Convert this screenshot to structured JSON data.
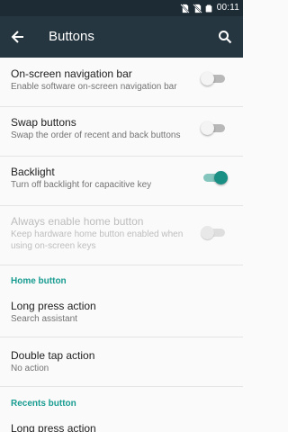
{
  "status_bar": {
    "time": "00:11",
    "icons": [
      "no-sim-icon",
      "no-sim-icon",
      "battery-icon"
    ]
  },
  "app_bar": {
    "title": "Buttons",
    "back_icon": "back-arrow-icon",
    "search_icon": "search-icon"
  },
  "settings": [
    {
      "title": "On-screen navigation bar",
      "subtitle": "Enable software on-screen navigation bar",
      "toggle": "off"
    },
    {
      "title": "Swap buttons",
      "subtitle": "Swap the order of recent and back buttons",
      "toggle": "off"
    },
    {
      "title": "Backlight",
      "subtitle": "Turn off backlight for capacitive key",
      "toggle": "on"
    },
    {
      "title": "Always enable home button",
      "subtitle": "Keep hardware home button enabled when using on-screen keys",
      "toggle": "off",
      "enabled": false
    }
  ],
  "home_button_section": {
    "header": "Home button",
    "items": [
      {
        "title": "Long press action",
        "subtitle": "Search assistant"
      },
      {
        "title": "Double tap action",
        "subtitle": "No action"
      }
    ]
  },
  "recents_button_section": {
    "header": "Recents button",
    "items": [
      {
        "title": "Long press action"
      }
    ]
  },
  "colors": {
    "status_bar": "#1d2b35",
    "app_bar": "#263640",
    "accent": "#199c91",
    "toggle_on": "#1a8f84"
  }
}
